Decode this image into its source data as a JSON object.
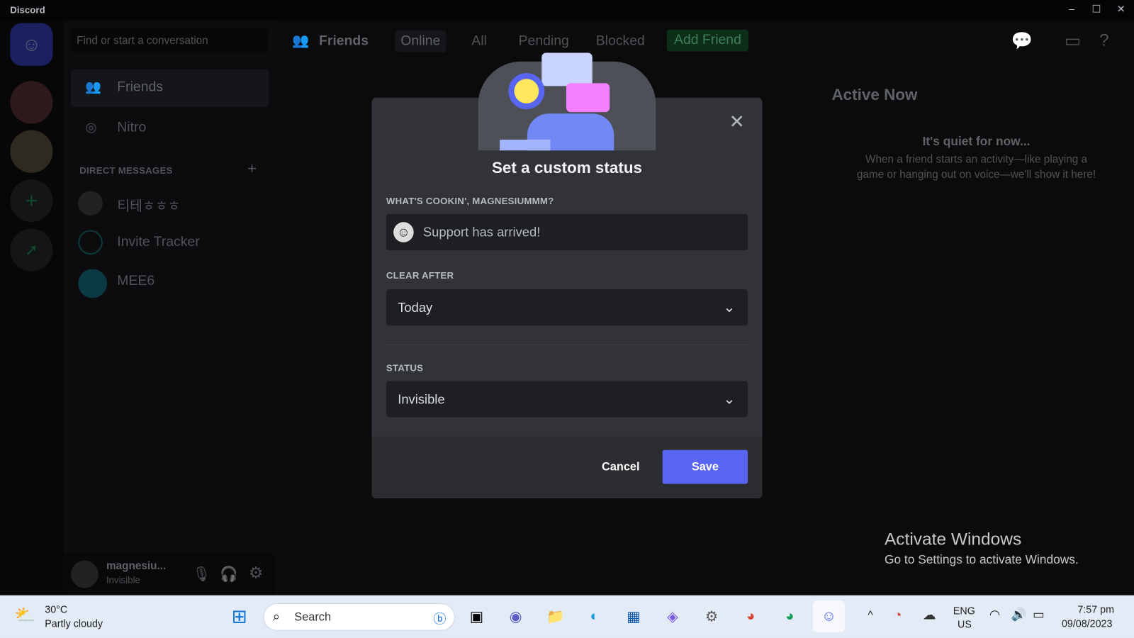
{
  "app": {
    "title": "Discord"
  },
  "sidebar": {
    "search_placeholder": "Find or start a conversation",
    "friends": "Friends",
    "nitro": "Nitro",
    "dm_header": "DIRECT MESSAGES",
    "dms": [
      {
        "name": "티테ㅎㅎㅎ"
      },
      {
        "name": "Invite Tracker"
      },
      {
        "name": "MEE6"
      }
    ],
    "user": {
      "name": "magnesiu...",
      "status": "Invisible"
    }
  },
  "header": {
    "title": "Friends",
    "tabs": [
      "Online",
      "All",
      "Pending",
      "Blocked"
    ],
    "add_friend": "Add Friend"
  },
  "active_now": {
    "title": "Active Now",
    "empty_title": "It's quiet for now...",
    "empty_text_1": "When a friend starts an activity—like playing a",
    "empty_text_2": "game or hanging out on voice—we'll show it here!"
  },
  "modal": {
    "title": "Set a custom status",
    "prompt_label": "WHAT'S COOKIN', MAGNESIUMMM?",
    "status_text_value": "Support has arrived!",
    "clear_after_label": "CLEAR AFTER",
    "clear_after_value": "Today",
    "status_label": "STATUS",
    "status_value": "Invisible",
    "cancel": "Cancel",
    "save": "Save"
  },
  "watermark": {
    "title": "Activate Windows",
    "text": "Go to Settings to activate Windows."
  },
  "taskbar": {
    "weather_temp": "30°C",
    "weather_desc": "Partly cloudy",
    "search": "Search",
    "lang1": "ENG",
    "lang2": "US",
    "time": "7:57 pm",
    "date": "09/08/2023"
  },
  "colors": {
    "accent": "#5865f2",
    "add_friend": "#248046",
    "bg": "#313338"
  }
}
